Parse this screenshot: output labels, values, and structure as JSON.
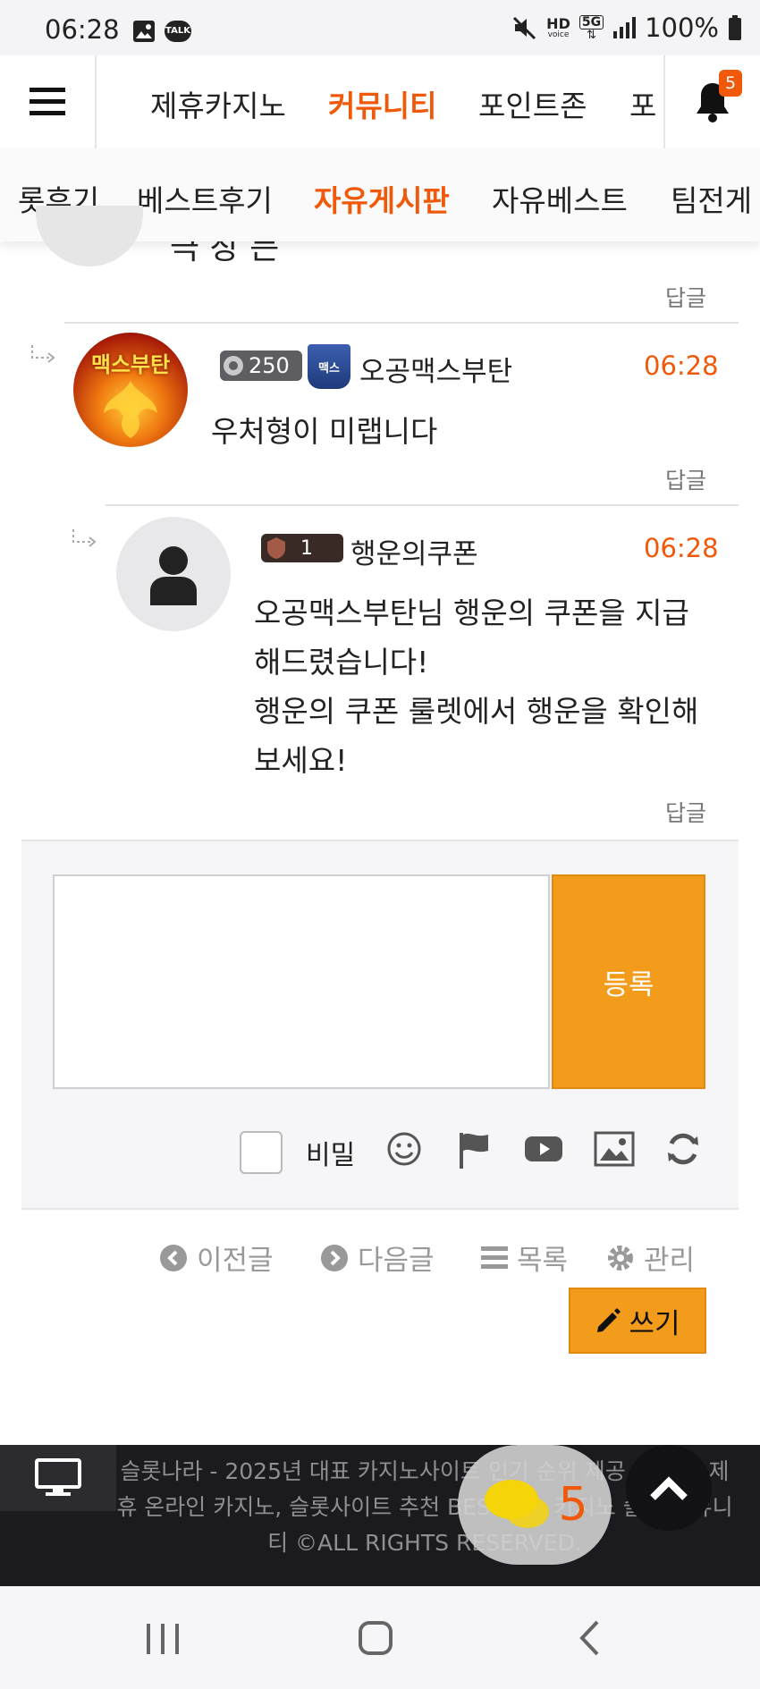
{
  "status_bar": {
    "time": "06:28",
    "battery": "100%",
    "network": "5G",
    "hd_label": "HD",
    "voice_label": "voice",
    "talk_label": "TALK"
  },
  "nav": {
    "items": [
      "제휴카지노",
      "커뮤니티",
      "포인트존",
      "포"
    ],
    "active": "커뮤니티",
    "notification_count": "5"
  },
  "subnav": {
    "items": [
      "롯후기",
      "베스트후기",
      "자유게시판",
      "자유베스트",
      "팀전게"
    ],
    "active": "자유게시판"
  },
  "partial_comment": {
    "text": "극 장 든",
    "reply_label": "답글"
  },
  "comments": [
    {
      "level": "250",
      "avatar_text": "맥스부탄",
      "badge_text": "맥스",
      "nickname": "오공맥스부탄",
      "time": "06:28",
      "text": "우처형이 미랩니다",
      "reply_label": "답글"
    },
    {
      "level": "1",
      "nickname": "행운의쿠폰",
      "time": "06:28",
      "lines": [
        "오공맥스부탄님 행운의 쿠폰을 지급",
        "해드렸습니다!",
        "행운의 쿠폰 룰렛에서 행운을 확인해",
        "보세요!"
      ],
      "reply_label": "답글"
    }
  ],
  "form": {
    "submit_label": "등록",
    "secret_label": "비밀",
    "input_value": ""
  },
  "post_nav": {
    "prev": "이전글",
    "next": "다음글",
    "list": "목록",
    "manage": "관리",
    "write": "쓰기"
  },
  "footer": {
    "text": "슬롯나라 - 2025년 대표 카지노사이트 인기 순위 제공, 최정상 제휴 온라인 카지노, 슬롯사이트 추천 BEST 12, 카지노 슬롯 커뮤니티 ©ALL RIGHTS RESERVED."
  },
  "chat_widget": {
    "count": "5"
  },
  "colors": {
    "accent": "#f0590a",
    "button": "#f39c1c"
  }
}
